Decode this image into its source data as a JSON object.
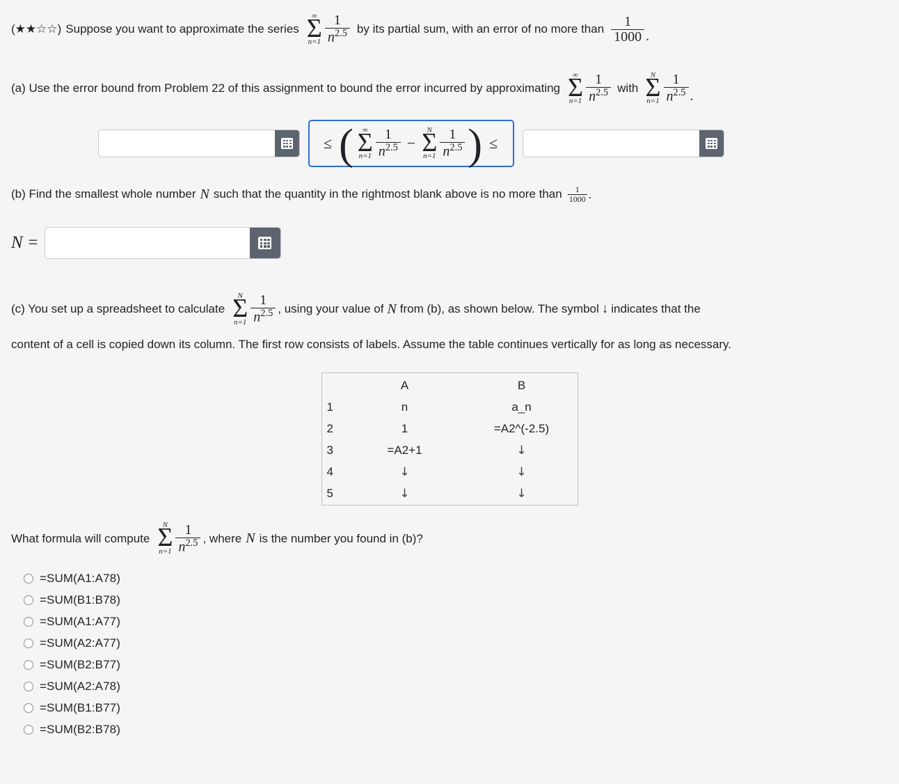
{
  "problem": {
    "difficulty_stars": "(★★☆☆)",
    "intro_text_before": "Suppose you want to approximate the series",
    "intro_series": {
      "sum_upper": "∞",
      "sum_lower": "n=1",
      "num": "1",
      "den_base": "n",
      "den_exp": "2.5"
    },
    "intro_text_middle": "by its partial sum, with an error of no more than",
    "intro_bound": {
      "num": "1",
      "den": "1000"
    },
    "intro_text_end": "."
  },
  "part_a": {
    "label_text": "(a) Use the error bound from Problem 22 of this assignment to bound the error incurred by approximating",
    "series_infinite": {
      "sum_upper": "∞",
      "sum_lower": "n=1",
      "num": "1",
      "den_base": "n",
      "den_exp": "2.5"
    },
    "with_text": "with",
    "series_partial": {
      "sum_upper": "N",
      "sum_lower": "n=1",
      "num": "1",
      "den_base": "n",
      "den_exp": "2.5"
    },
    "end_text": ".",
    "left_blank_value": "",
    "left_blank_placeholder": "",
    "right_blank_value": "",
    "right_blank_placeholder": "",
    "relation_left": "≤",
    "relation_right": "≤",
    "paren_open": "(",
    "paren_close": ")",
    "minus": "−",
    "keypad_icon": "grid-keypad-icon",
    "box_border_color": "#2f6bd8"
  },
  "part_b": {
    "text_before": "(b) Find the smallest whole number",
    "variable": "N",
    "text_after": "such that the quantity in the rightmost blank above is no more than",
    "bound": {
      "num": "1",
      "den": "1000"
    },
    "period": ".",
    "answer_label": "N =",
    "answer_value": "",
    "answer_placeholder": "",
    "keypad_icon": "grid-keypad-icon"
  },
  "part_c": {
    "text_before": "(c) You set up a spreadsheet to calculate",
    "series": {
      "sum_upper": "N",
      "sum_lower": "n=1",
      "num": "1",
      "den_base": "n",
      "den_exp": "2.5"
    },
    "text_after": ", using your value of",
    "variable": "N",
    "text_after_2": "from (b), as shown below. The symbol",
    "down_arrow": "↓",
    "text_after_3": "indicates that the",
    "paragraph": "content of a cell is copied down its column. The first row consists of labels. Assume the table continues vertically for as long as necessary.",
    "spreadsheet": {
      "columns": [
        "",
        "A",
        "B"
      ],
      "rows": [
        {
          "num": "1",
          "a": "n",
          "b": "a_n"
        },
        {
          "num": "2",
          "a": "1",
          "b": "=A2^(-2.5)"
        },
        {
          "num": "3",
          "a": "=A2+1",
          "b": "↓"
        },
        {
          "num": "4",
          "a": "↓",
          "b": "↓"
        },
        {
          "num": "5",
          "a": "↓",
          "b": "↓"
        }
      ]
    },
    "question_before": "What formula will compute",
    "question_series": {
      "sum_upper": "N",
      "sum_lower": "n=1",
      "num": "1",
      "den_base": "n",
      "den_exp": "2.5"
    },
    "question_after": ", where",
    "question_variable": "N",
    "question_after_2": "is the number you found in (b)?",
    "options": [
      "=SUM(A1:A78)",
      "=SUM(B1:B78)",
      "=SUM(A1:A77)",
      "=SUM(A2:A77)",
      "=SUM(B2:B77)",
      "=SUM(A2:A78)",
      "=SUM(B1:B77)",
      "=SUM(B2:B78)"
    ],
    "selected_option": null
  },
  "theme": {
    "page_background": "#f5f5f5",
    "text_color": "#1f2125",
    "input_background": "#ffffff",
    "keypad_button_color": "#5d6470",
    "accent_blue": "#2f6bd8",
    "table_border": "#bfbfbf"
  }
}
